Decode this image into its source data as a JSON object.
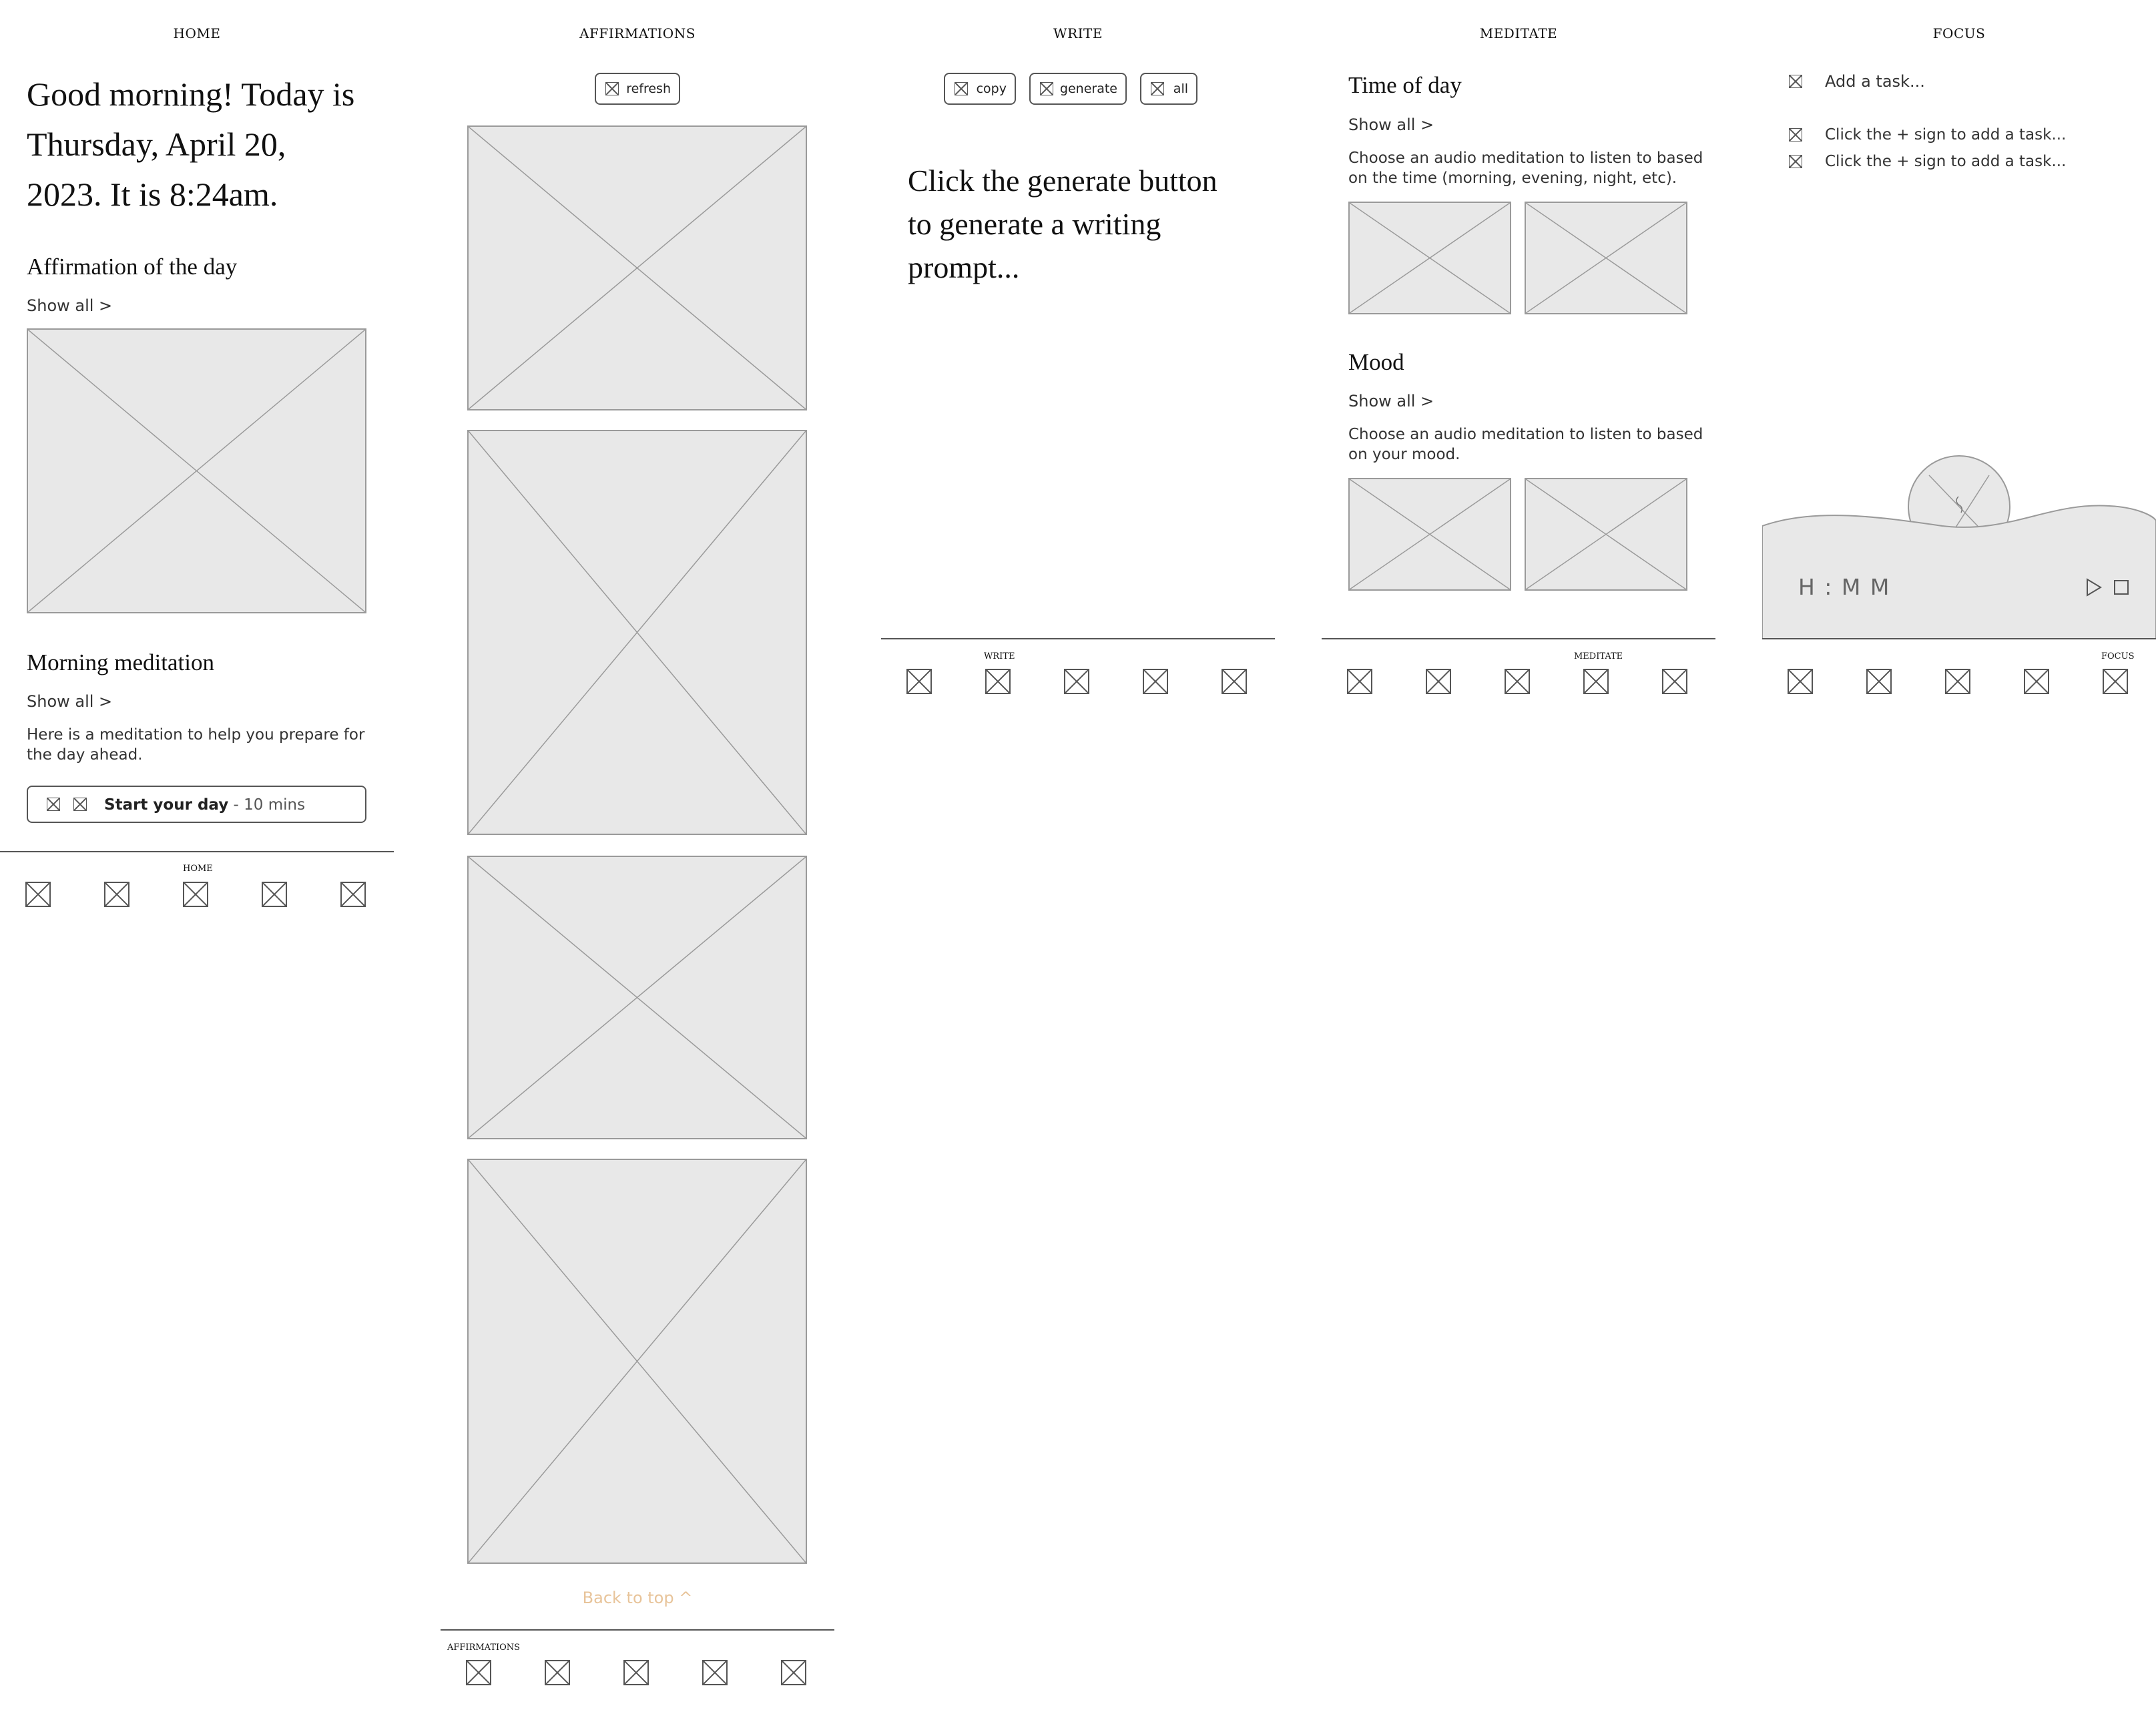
{
  "home": {
    "title": "HOME",
    "greeting_lines": [
      "Good morning! Today is",
      "Thursday, April 20,",
      "2023. It is 8:24am."
    ],
    "affirmation_heading": "Affirmation of the day",
    "affirmation_show_all": "Show all >",
    "meditation_heading": "Morning meditation",
    "meditation_show_all": "Show all >",
    "meditation_desc_lines": [
      "Here is a meditation to help you prepare for",
      "the day ahead."
    ],
    "start_button": {
      "bold": "Start your day",
      "rest": " - 10 mins"
    },
    "nav_active_label": "HOME"
  },
  "affirmations": {
    "title": "AFFIRMATIONS",
    "refresh_label": "refresh",
    "back_to_top": "Back to top  ^",
    "nav_active_label": "AFFIRMATIONS",
    "back_to_top_color": "#e8c49a"
  },
  "write": {
    "title": "WRITE",
    "copy_label": "copy",
    "generate_label": "generate",
    "all_label": "all",
    "prompt_lines": [
      "Click the generate button",
      "to generate a writing",
      "prompt..."
    ],
    "nav_active_label": "WRITE"
  },
  "meditate": {
    "title": "MEDITATE",
    "time_heading": "Time of day",
    "time_show_all": "Show all >",
    "time_desc_lines": [
      "Choose an audio meditation to listen to based",
      "on the time (morning, evening, night, etc)."
    ],
    "mood_heading": "Mood",
    "mood_show_all": "Show all >",
    "mood_desc_lines": [
      "Choose an audio meditation to listen to based",
      "on your mood."
    ],
    "nav_active_label": "MEDITATE"
  },
  "focus": {
    "title": "FOCUS",
    "add_task_placeholder": "Add a task...",
    "tasks": [
      "Click the + sign to add a task...",
      "Click the + sign to add a task..."
    ],
    "timer_text": "H : M M",
    "play_icon": "play-icon",
    "stop_icon": "stop-icon",
    "nav_active_label": "FOCUS"
  }
}
